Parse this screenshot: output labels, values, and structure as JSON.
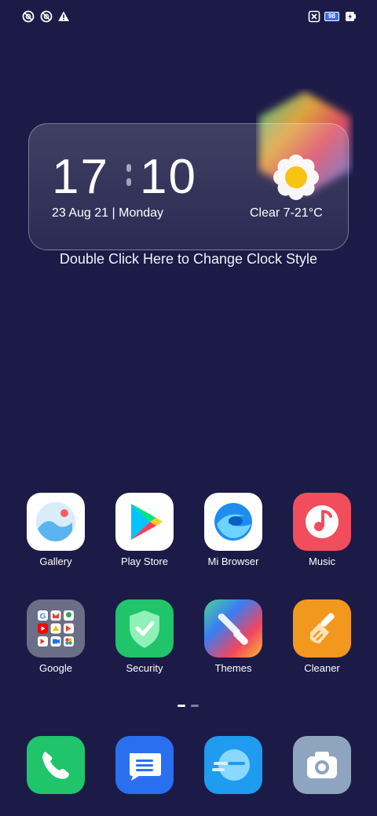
{
  "status_bar": {
    "left_icons": [
      "do-not-disturb-icon",
      "vpn-icon",
      "warning-icon"
    ],
    "right_icons": [
      "sim-off-icon",
      "battery-icon",
      "charging-icon"
    ],
    "battery_level": "98"
  },
  "clock_widget": {
    "hour": "17",
    "minute": "10",
    "date": "23 Aug 21 | Monday",
    "weather": "Clear  7-21°C",
    "weather_icon": "sun-icon",
    "hint": "Double Click Here to Change Clock Style"
  },
  "apps": [
    {
      "label": "Gallery",
      "icon": "gallery-icon"
    },
    {
      "label": "Play Store",
      "icon": "play-store-icon"
    },
    {
      "label": "Mi Browser",
      "icon": "browser-icon"
    },
    {
      "label": "Music",
      "icon": "music-icon"
    },
    {
      "label": "Google",
      "icon": "google-folder-icon"
    },
    {
      "label": "Security",
      "icon": "security-icon"
    },
    {
      "label": "Themes",
      "icon": "themes-icon"
    },
    {
      "label": "Cleaner",
      "icon": "cleaner-icon"
    }
  ],
  "dock": [
    {
      "icon": "phone-icon"
    },
    {
      "icon": "messages-icon"
    },
    {
      "icon": "browser-icon"
    },
    {
      "icon": "camera-icon"
    }
  ],
  "page_indicator": {
    "pages": 2,
    "current": 1
  },
  "colors": {
    "background": "#1c1b47",
    "music": "#f24d5c",
    "security": "#1fc46b",
    "cleaner": "#f3981e",
    "phone": "#1fc46b",
    "messages": "#2a6ff0",
    "browser": "#1f9bf0",
    "camera": "#8fa4bf"
  }
}
